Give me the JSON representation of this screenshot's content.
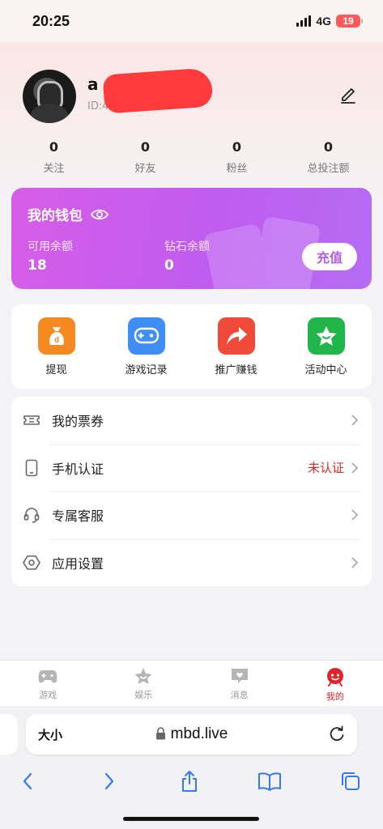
{
  "status_bar": {
    "time": "20:25",
    "network": "4G",
    "battery": "19"
  },
  "profile": {
    "username": "a",
    "user_id": "ID:4"
  },
  "stats": [
    {
      "value": "0",
      "label": "关注"
    },
    {
      "value": "0",
      "label": "好友"
    },
    {
      "value": "0",
      "label": "粉丝"
    },
    {
      "value": "0",
      "label": "总投注额"
    }
  ],
  "wallet": {
    "title": "我的钱包",
    "available_label": "可用余额",
    "available_value": "18",
    "diamond_label": "钻石余额",
    "diamond_value": "0",
    "recharge_label": "充值"
  },
  "quick_actions": [
    {
      "label": "提现",
      "icon": "money-bag-icon",
      "color": "#f6891f"
    },
    {
      "label": "游戏记录",
      "icon": "gamepad-icon",
      "color": "#3f8ef5"
    },
    {
      "label": "推广赚钱",
      "icon": "share-arrow-icon",
      "color": "#ef4a3a"
    },
    {
      "label": "活动中心",
      "icon": "star-icon",
      "color": "#21b54a"
    }
  ],
  "menu": [
    {
      "label": "我的票券",
      "icon": "ticket-icon",
      "status": ""
    },
    {
      "label": "手机认证",
      "icon": "phone-icon",
      "status": "未认证"
    },
    {
      "label": "专属客服",
      "icon": "headset-icon",
      "status": ""
    },
    {
      "label": "应用设置",
      "icon": "settings-icon",
      "status": ""
    }
  ],
  "tabbar": [
    {
      "label": "游戏",
      "icon": "gamepad-tab-icon",
      "active": false
    },
    {
      "label": "娱乐",
      "icon": "star-tab-icon",
      "active": false
    },
    {
      "label": "消息",
      "icon": "message-tab-icon",
      "active": false
    },
    {
      "label": "我的",
      "icon": "profile-tab-icon",
      "active": true
    }
  ],
  "browser": {
    "text_size_label": "大小",
    "url": "mbd.live"
  },
  "colors": {
    "accent": "#e0242b",
    "wallet": "#c05cf0"
  }
}
